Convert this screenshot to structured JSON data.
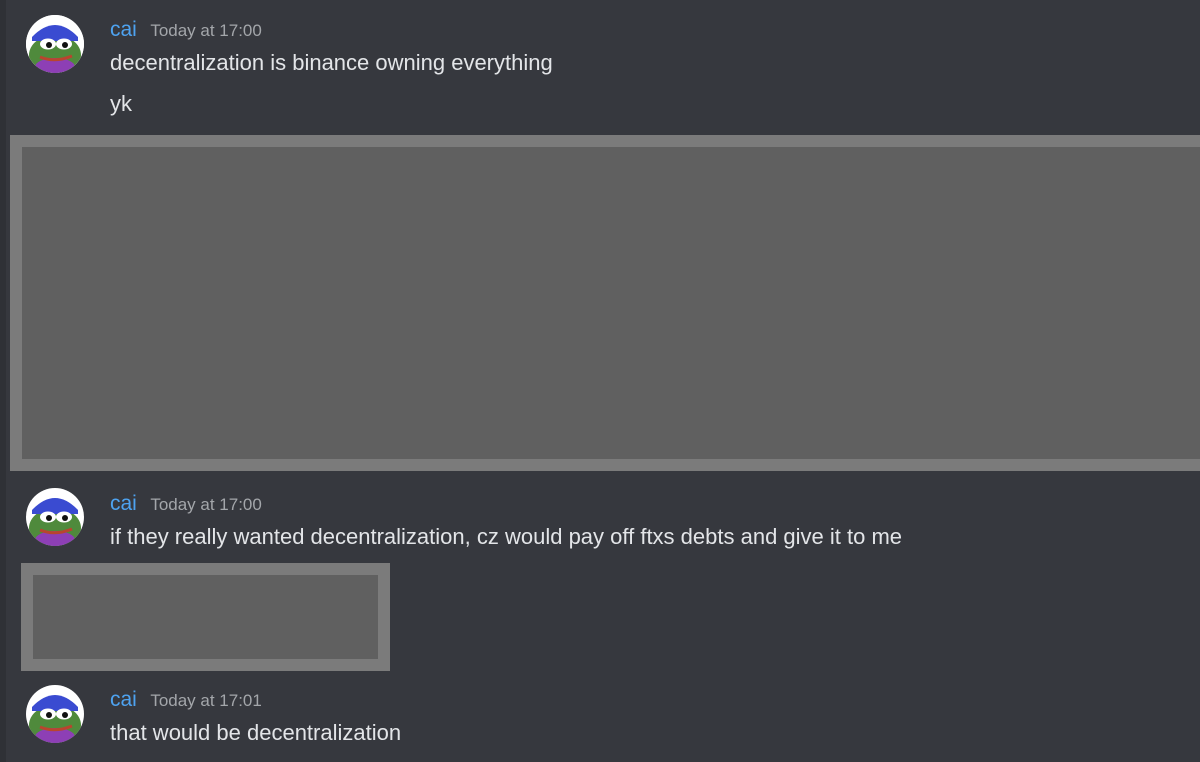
{
  "colors": {
    "background": "#36383e",
    "username": "#4ea3f0",
    "timestamp": "#a3a6aa",
    "message_text": "#e3e5e8",
    "redacted_fill": "#606060",
    "redacted_border": "#7b7b7b"
  },
  "messages": [
    {
      "username": "cai",
      "timestamp": "Today at 17:00",
      "avatar_icon": "frog-avatar-icon",
      "lines": [
        "decentralization is binance owning everything",
        "yk"
      ]
    },
    {
      "username": "cai",
      "timestamp": "Today at 17:00",
      "avatar_icon": "frog-avatar-icon",
      "lines": [
        "if they really wanted decentralization, cz would pay off ftxs debts and give it to me"
      ]
    },
    {
      "username": "cai",
      "timestamp": "Today at 17:01",
      "avatar_icon": "frog-avatar-icon",
      "lines": [
        "that would be decentralization"
      ]
    }
  ]
}
